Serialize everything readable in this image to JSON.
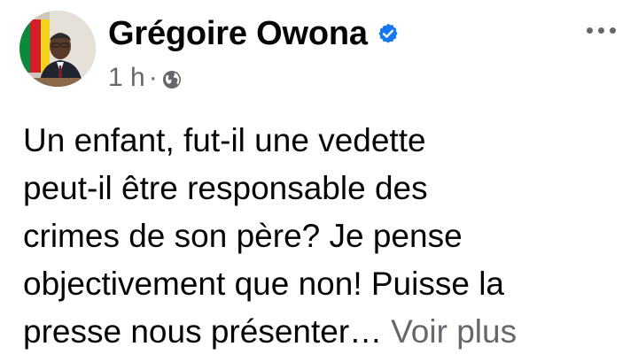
{
  "post": {
    "author_name": "Grégoire Owona",
    "timestamp": "1 h",
    "separator": "·",
    "audience_icon": "globe-icon",
    "verified_icon": "verified-badge-icon",
    "verified_color": "#1877f2",
    "more_icon": "more-options-icon",
    "text_lines": [
      "Un enfant, fut-il une vedette",
      "peut-il être responsable des",
      "crimes de son père? Je pense",
      "objectivement que non! Puisse la",
      "presse nous présenter…"
    ],
    "see_more_label": "Voir plus"
  }
}
